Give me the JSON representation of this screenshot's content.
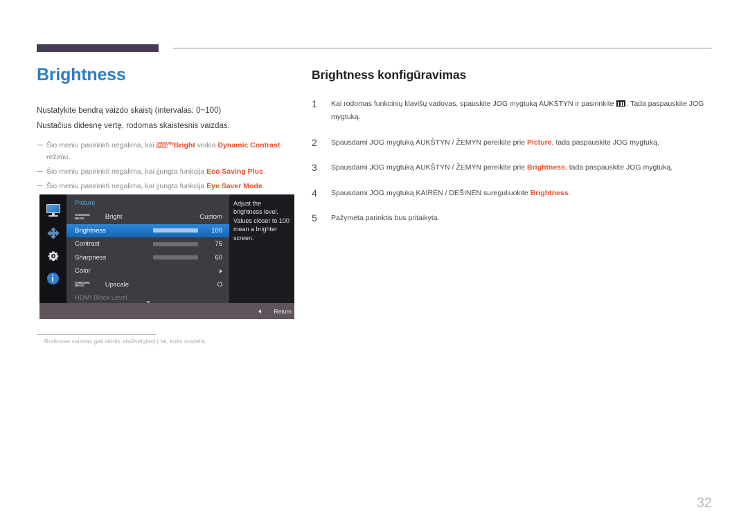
{
  "page": {
    "number": "32",
    "caption_note": "Rodomas vaizdas gali skirtis atsižvelgiant į tai, koks modelis.",
    "accent_blue": "#2f7ec0",
    "accent_orange": "#e8502a",
    "rule_purple": "#453b52"
  },
  "left": {
    "title": "Brightness",
    "lead_1": "Nustatykite bendrą vaizdo skaistį (intervalas: 0~100)",
    "lead_2": "Nustačius didesnę vertę, rodomas skaistesnis vaizdas.",
    "notes": [
      {
        "before": "Šio meniu pasirinkti negalima, kai ",
        "magic_top": "SAMSUNG",
        "magic_bottom": "MAGIC",
        "bold_1": "Bright",
        "middle": " veikia ",
        "bold_2": "Dynamic Contrast",
        "after": " režimu."
      },
      {
        "before": "Šio meniu pasirinkti negalima, kai įjungta funkcija ",
        "bold_1": "Eco Saving Plus",
        "after": "."
      },
      {
        "before": "Šio meniu pasirinkti negalima, kai įjungta funkcija ",
        "bold_1": "Eye Saver Mode",
        "after": "."
      }
    ]
  },
  "osd": {
    "menu_title": "Picture",
    "rail_icons": [
      "monitor-icon",
      "four-way-arrows-icon",
      "gear-icon",
      "info-icon"
    ],
    "rows": [
      {
        "type": "magic",
        "magic_top": "SAMSUNG",
        "magic_bottom": "MAGIC",
        "label": "Bright",
        "value": "Custom"
      },
      {
        "type": "slider",
        "label": "Brightness",
        "value": "100",
        "fill_pct": 100,
        "selected": true
      },
      {
        "type": "slider",
        "label": "Contrast",
        "value": "75",
        "fill_pct": 75,
        "selected": false
      },
      {
        "type": "slider",
        "label": "Sharpness",
        "value": "60",
        "fill_pct": 60,
        "selected": false
      },
      {
        "type": "submenu",
        "label": "Color",
        "value": "",
        "selected": false
      },
      {
        "type": "magic",
        "magic_top": "SAMSUNG",
        "magic_bottom": "MAGIC",
        "label": "Upscale",
        "value": "O"
      },
      {
        "type": "dim",
        "label": "HDMI Black Level",
        "value": ""
      }
    ],
    "help_text": "Adjust the brightness level. Values closer to 100 mean a brighter screen.",
    "footer_label": "Return"
  },
  "right": {
    "title": "Brightness konfigūravimas",
    "steps": [
      {
        "num": "1",
        "before": "Kai rodomas funkcinių klavišų vadovas, spauskite JOG mygtuką AUKŠTYN ir pasirinkite ",
        "glyph": "menu-icon",
        "after": ". Tada paspauskite JOG mygtuką."
      },
      {
        "num": "2",
        "before": "Spausdami JOG mygtuką AUKŠTYN / ŽEMYN pereikite prie ",
        "bold": "Picture",
        "after": ", tada paspauskite JOG mygtuką."
      },
      {
        "num": "3",
        "before": "Spausdami JOG mygtuką AUKŠTYN / ŽEMYN pereikite prie ",
        "bold": "Brightness",
        "after": ", tada paspauskite JOG mygtuką."
      },
      {
        "num": "4",
        "before": "Spausdami JOG mygtuką KAIRĖN / DEŠINĖN sureguliuokite ",
        "bold": "Brightness",
        "after": "."
      },
      {
        "num": "5",
        "before": "Pažymėta parinktis bus pritaikyta.",
        "bold": "",
        "after": ""
      }
    ]
  }
}
